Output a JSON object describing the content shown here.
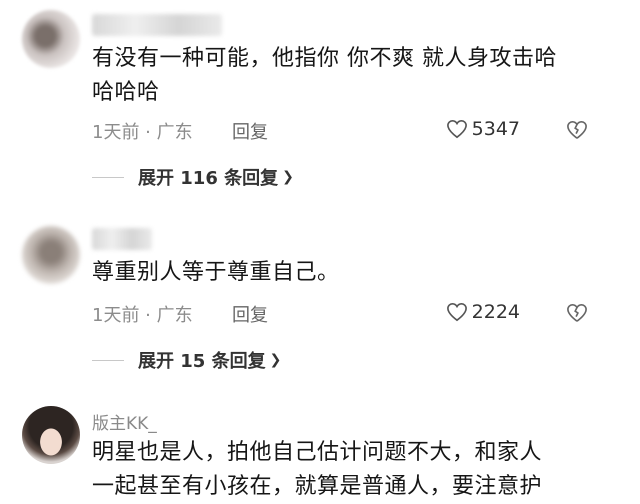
{
  "comments": [
    {
      "username": "",
      "text_line1": "有没有一种可能，他指你 你不爽 就人身攻击哈",
      "text_line2": "哈哈哈",
      "meta": "1天前 · 广东",
      "reply": "回复",
      "likes": "5347",
      "expand": "展开 116 条回复"
    },
    {
      "username": "",
      "text_line1": "尊重别人等于尊重自己。",
      "meta": "1天前 · 广东",
      "reply": "回复",
      "likes": "2224",
      "expand": "展开 15 条回复"
    },
    {
      "username": "版主KK_",
      "text_line1": "明星也是人，拍他自己估计问题不大，和家人",
      "text_line2": "一起甚至有小孩在，就算是普通人，要注意护"
    }
  ],
  "icons": {
    "like": "heart-outline-icon",
    "dislike": "broken-heart-icon",
    "expand": "chevron-down-icon"
  }
}
